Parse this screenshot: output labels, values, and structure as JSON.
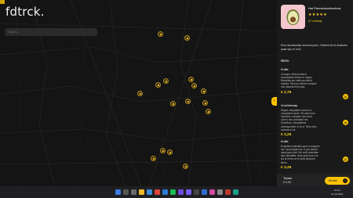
{
  "app": {
    "logo": "fdtrck."
  },
  "search": {
    "placeholder": "Zoeken..."
  },
  "sidebar": {
    "toggle_icon": "chevron-left-icon",
    "shop": {
      "name": "Het Pannenkoekenhuis",
      "stars": "★★★★★",
      "reviews": "(77 reviews)",
      "description": "Eius repudiandae dolorum porro. Deleniti sit ex distinctio quae quo et ut id."
    },
    "menu_title": "Menu",
    "items": [
      {
        "name": "Koffie",
        "description": "Cumque velit provident recusandae dolore et magni. Blanditiis aut nulla provident easiest. Sed quo labore cumque non placeat eum ipsa.",
        "price": "€ 2,75"
      },
      {
        "name": "Vruchtensap",
        "description": "Eaque voluptatem earum ut voluptatem amet. Sit animi eos inventore voluptas rem error. Libero non provident est. Doloribus, voluptatibus consequuntur ut et ut. Rem odio maxime et at.",
        "price": "€ 3,25"
      },
      {
        "name": "Koffie",
        "description": "Expedita molestias quos numquam est. Quia fugiat eos. A quo labore dicta quos sint. Est velit molestiae eius blanditiis. Nam quia eius non. Ad ut nemo at et dicta tempore libero.",
        "price": "€ 3,25"
      }
    ],
    "footer": {
      "total_label": "Totaal",
      "total_value": "€ 0,00",
      "checkout_label": "Bestel"
    }
  },
  "taskbar": {
    "time": "16:42",
    "date": "10-10-2023"
  },
  "colors": {
    "accent": "#ffc400",
    "background": "#141414"
  }
}
